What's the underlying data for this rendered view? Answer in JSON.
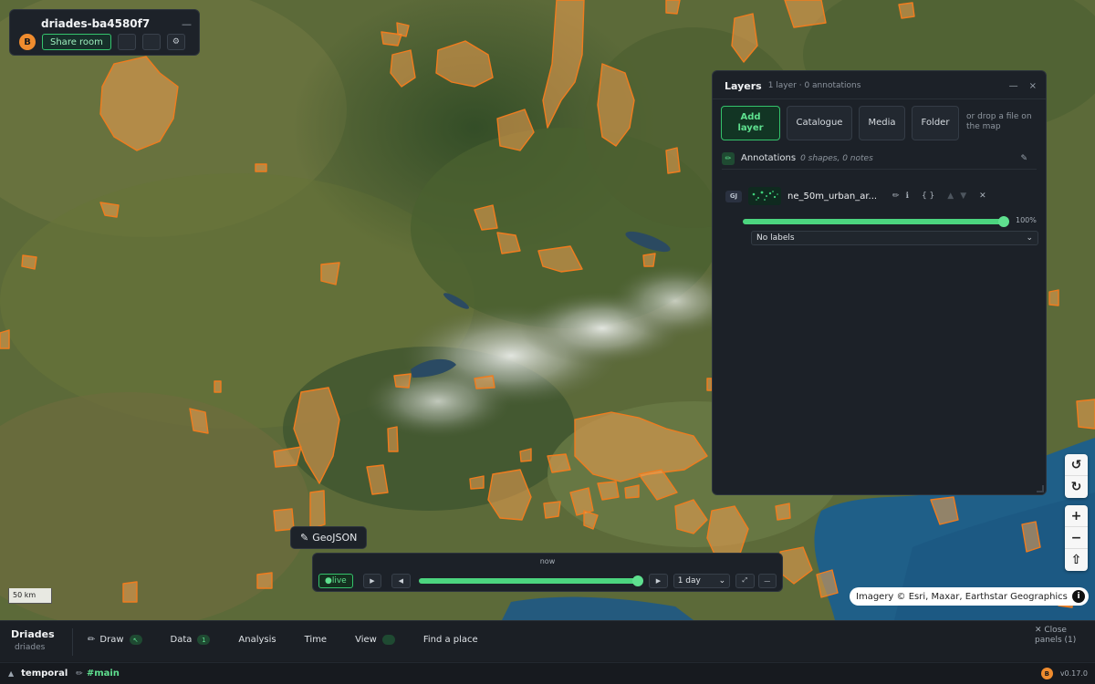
{
  "room": {
    "icon": "room-icon",
    "title": "driades-ba4580f7",
    "minimize_label": "—",
    "avatar_initial": "B",
    "share_label": "Share room",
    "button_icons": [
      "copy-icon",
      "link-icon",
      "gear-icon"
    ],
    "button_glyphs": [
      "",
      "",
      "⚙"
    ]
  },
  "layers_panel": {
    "icon": "",
    "title": "Layers",
    "subtitle": "1 layer · 0 annotations",
    "minimize_label": "—",
    "close_label": "×",
    "buttons": [
      {
        "icon": "",
        "label": "Add layer"
      },
      {
        "icon": "",
        "label": "Catalogue"
      },
      {
        "icon": "",
        "label": "Media"
      },
      {
        "icon": "",
        "label": "Folder"
      }
    ],
    "drop_hint": "or drop a file on the map",
    "annotations": {
      "badge": "✏",
      "label": "Annotations",
      "counts": "0 shapes, 0 notes",
      "edit_glyph": "✎",
      "more_glyph": ""
    },
    "layer": {
      "type_badge": "GJ",
      "name": "ne_50m_urban_ar...",
      "actions": [
        "✏",
        "ℹ",
        "",
        "{ }",
        "",
        "▲",
        "▼",
        "",
        "✕"
      ],
      "opacity": 100,
      "opacity_label": "100%",
      "label_icon": "",
      "label_select": "No labels",
      "select_caret": "⌄"
    }
  },
  "map": {
    "attribution": "Imagery © Esri, Maxar, Earthstar Geographics",
    "info_glyph": "i",
    "scale_label": "50 km",
    "controls_rotate": [
      "↺",
      "↻"
    ],
    "controls_zoom": [
      "+",
      "−",
      "⇧"
    ],
    "urban_fill": "#f0a050",
    "urban_stroke": "#f07c1e"
  },
  "geojson_tooltip": {
    "glyph": "✎",
    "label": "GeoJSON"
  },
  "timeline": {
    "now_label": "now",
    "live_label": "●live",
    "play_glyph": "▶",
    "back_glyph": "◀",
    "forward_glyph": "▶",
    "progress": 1.0,
    "step_select": "1 day",
    "select_caret": "⌄",
    "expand_glyph": "⤢",
    "collapse_glyph": "—"
  },
  "toolbar": {
    "brand_name": "Driades ",
    "brand_sub": " driades",
    "items": [
      {
        "icon": "✏",
        "label": "Draw",
        "badge": "↖"
      },
      {
        "icon": "",
        "label": "Data",
        "badge": "1"
      },
      {
        "icon": "",
        "label": "Analysis",
        "badge": ""
      },
      {
        "icon": "",
        "label": "Time",
        "badge": ""
      },
      {
        "icon": "",
        "label": "View",
        "badge": ""
      },
      {
        "icon": "",
        "label": "Find a place",
        "badge": ""
      }
    ],
    "close_panels": "✕ Close panels (1)"
  },
  "statusbar": {
    "caret": "▲",
    "icon": "",
    "namespace": "temporal",
    "pen": "✏",
    "branch": "#main",
    "avatar_initial": "B",
    "version": "v0.17.0"
  }
}
